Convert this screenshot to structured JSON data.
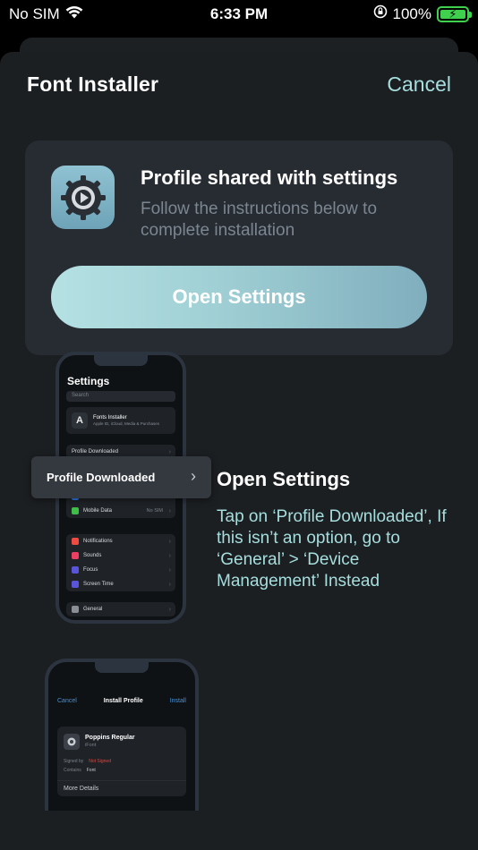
{
  "status_bar": {
    "carrier": "No SIM",
    "time": "6:33 PM",
    "battery": "100%"
  },
  "header": {
    "title": "Font Installer",
    "cancel_label": "Cancel"
  },
  "profile_card": {
    "title": "Profile shared with settings",
    "subtitle": "Follow the instructions below to complete installation",
    "button_label": "Open Settings"
  },
  "step1": {
    "title": "Open Settings",
    "description": "Tap on ‘Profile Downloaded’, If this isn’t an option, go to ‘General’ > ‘Device Management’ Instead",
    "callout_label": "Profile Downloaded",
    "mock": {
      "title": "Settings",
      "search_placeholder": "Search",
      "app_name": "Fonts Installer",
      "app_sub": "Apple ID, iCloud, Media & Purchases",
      "row_profile": "Profile Downloaded",
      "bluetooth": "Bluetooth",
      "bluetooth_value": "Not Connected",
      "mobile": "Mobile Data",
      "mobile_value": "No SIM",
      "notifications": "Notifications",
      "sounds": "Sounds",
      "focus": "Focus",
      "screen_time": "Screen Time",
      "general": "General"
    }
  },
  "step2": {
    "mock": {
      "cancel": "Cancel",
      "title": "Install Profile",
      "install": "Install",
      "profile_name": "Poppins Regular",
      "profile_sub": "iFont",
      "signed_label": "Signed by",
      "signed_value": "Not Signed",
      "contains_label": "Contains",
      "contains_value": "Font",
      "more": "More Details"
    }
  },
  "colors": {
    "accent": "#a6dede",
    "background": "#1c1f22",
    "card": "#272c33",
    "battery": "#3fd14e"
  }
}
